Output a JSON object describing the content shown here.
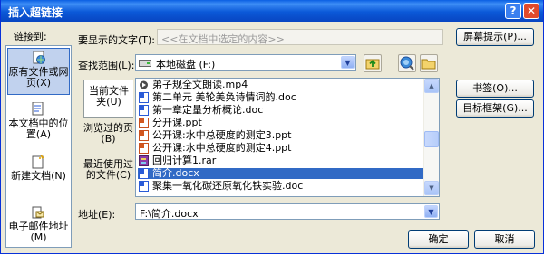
{
  "window": {
    "title": "插入超链接",
    "help": "?",
    "close": "✕"
  },
  "link_to": {
    "label": "链接到:",
    "items": [
      {
        "label": "原有文件或网页(X)",
        "icon": "globe-document-icon"
      },
      {
        "label": "本文档中的位置(A)",
        "icon": "document-place-icon"
      },
      {
        "label": "新建文档(N)",
        "icon": "new-document-icon"
      },
      {
        "label": "电子邮件地址(M)",
        "icon": "email-icon"
      }
    ]
  },
  "display_text": {
    "label": "要显示的文字(T):",
    "value": "<<在文档中选定的内容>>"
  },
  "screen_tip_button": "屏幕提示(P)...",
  "look_in": {
    "label": "查找范围(L):",
    "value": "本地磁盘 (F:)"
  },
  "tabs": [
    {
      "label": "当前文件夹(U)"
    },
    {
      "label": "浏览过的页(B)"
    },
    {
      "label": "最近使用过的文件(C)"
    }
  ],
  "files": [
    {
      "name": "弟子规全文朗读.mp4",
      "type": "media"
    },
    {
      "name": "第二单元 美轮美奂诗情词韵.doc",
      "type": "word"
    },
    {
      "name": "第一章定量分析概论.doc",
      "type": "word"
    },
    {
      "name": "分开课.ppt",
      "type": "ppt"
    },
    {
      "name": "公开课:水中总硬度的测定3.ppt",
      "type": "ppt"
    },
    {
      "name": "公开课:水中总硬度的测定4.ppt",
      "type": "ppt"
    },
    {
      "name": "回归计算1.rar",
      "type": "rar"
    },
    {
      "name": "简介.docx",
      "type": "word",
      "selected": true
    },
    {
      "name": "聚集一氧化碳还原氧化铁实验.doc",
      "type": "word"
    }
  ],
  "bookmark_button": "书签(O)...",
  "target_frame_button": "目标框架(G)...",
  "address": {
    "label": "地址(E):",
    "value": "F:\\简介.docx"
  },
  "ok_button": "确定",
  "cancel_button": "取消"
}
